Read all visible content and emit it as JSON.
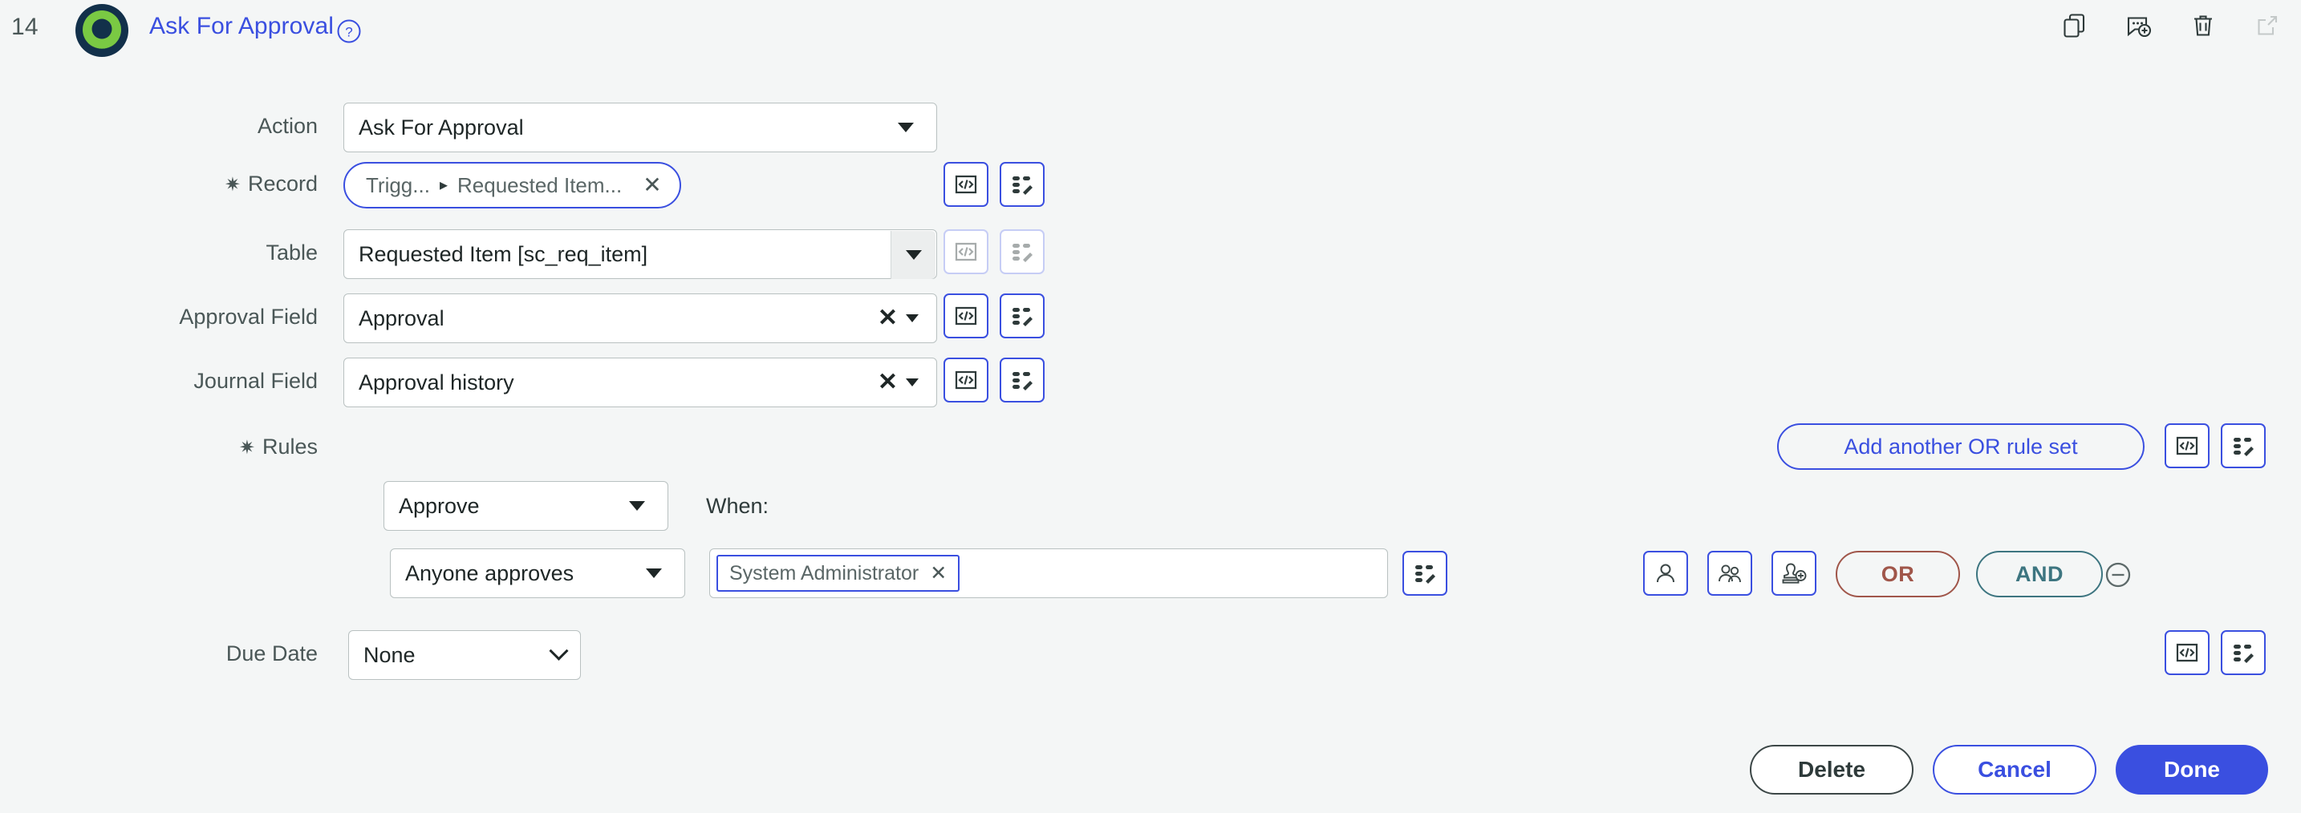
{
  "header": {
    "step_number": "14",
    "title": "Ask For Approval",
    "help_icon": "help-circle-icon",
    "logo_icon": "approval-ring-icon",
    "actions": [
      {
        "name": "duplicate-icon",
        "label": "Duplicate"
      },
      {
        "name": "add-comment-icon",
        "label": "Add comment"
      },
      {
        "name": "trash-icon",
        "label": "Delete"
      },
      {
        "name": "open-external-icon",
        "label": "Open in new window"
      }
    ]
  },
  "form": {
    "action": {
      "label": "Action",
      "value": "Ask For Approval",
      "required": false
    },
    "record": {
      "label": "Record",
      "required": true,
      "asterisk": "✷",
      "chip_prefix": "Trigg...",
      "chip_separator": "▸",
      "chip_value": "Requested Item...",
      "chip_clear": "✕"
    },
    "table": {
      "label": "Table",
      "value": "Requested Item [sc_req_item]",
      "required": false
    },
    "approval_field": {
      "label": "Approval Field",
      "value": "Approval",
      "clear": "✕",
      "required": false
    },
    "journal_field": {
      "label": "Journal Field",
      "value": "Approval history",
      "clear": "✕",
      "required": false
    },
    "rules": {
      "label": "Rules",
      "required": true,
      "asterisk": "✷",
      "add_rule_set_label": "Add another OR rule set",
      "decision": "Approve",
      "when_label": "When:",
      "condition": "Anyone approves",
      "approver_chip": "System Administrator",
      "approver_chip_clear": "✕",
      "or_label": "OR",
      "and_label": "AND",
      "remove_icon": "minus-circle-icon",
      "approver_type_icons": [
        {
          "name": "user-icon",
          "label": "User"
        },
        {
          "name": "user-group-icon",
          "label": "Group"
        },
        {
          "name": "approver-stamp-add-icon",
          "label": "Approver"
        }
      ]
    },
    "due_date": {
      "label": "Due Date",
      "value": "None",
      "options": [
        "None"
      ]
    },
    "row_tools": {
      "script_icon": "code-script-icon",
      "data_pill_icon": "data-pill-wand-icon"
    }
  },
  "footer": {
    "delete_label": "Delete",
    "cancel_label": "Cancel",
    "done_label": "Done"
  },
  "colors": {
    "background": "#f4f6f6",
    "accent_blue": "#3a4fe0",
    "or_red": "#a0564a",
    "and_teal": "#3d7580",
    "logo_green": "#7ac943",
    "logo_navy": "#12304a",
    "text": "#2e3a3a",
    "muted_text": "#5a6666"
  }
}
